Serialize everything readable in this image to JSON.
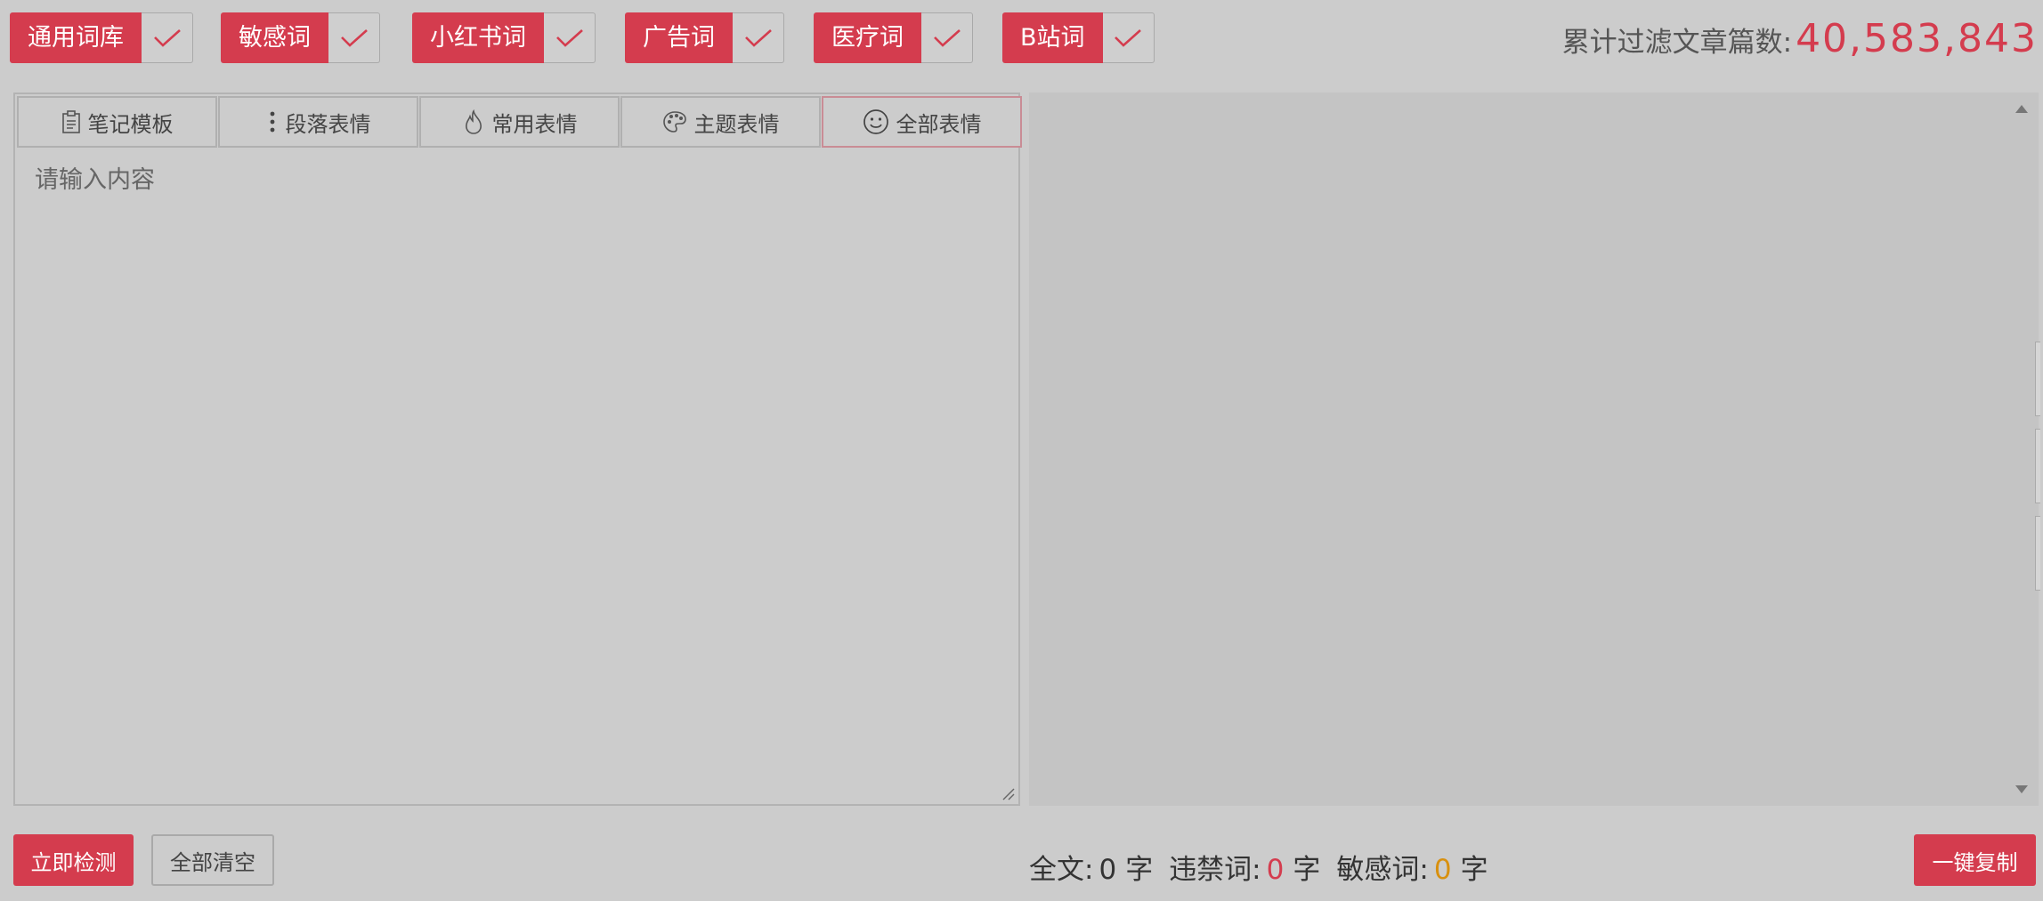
{
  "filters": {
    "tags": [
      {
        "label": "通用词库",
        "checked": true
      },
      {
        "label": "敏感词",
        "checked": true
      },
      {
        "label": "小红书词",
        "checked": true
      },
      {
        "label": "广告词",
        "checked": true
      },
      {
        "label": "医疗词",
        "checked": true
      },
      {
        "label": "B站词",
        "checked": true
      }
    ]
  },
  "counter": {
    "label": "累计过滤文章篇数:",
    "value": "40,583,843"
  },
  "toolbar": {
    "tabs": [
      {
        "label": "笔记模板",
        "icon": "clipboard-icon"
      },
      {
        "label": "段落表情",
        "icon": "vertical-dots-icon"
      },
      {
        "label": "常用表情",
        "icon": "fire-icon"
      },
      {
        "label": "主题表情",
        "icon": "palette-icon"
      },
      {
        "label": "全部表情",
        "icon": "smiley-icon",
        "active": true
      }
    ]
  },
  "editor": {
    "placeholder": "请输入内容",
    "value": ""
  },
  "actions": {
    "detect_label": "立即检测",
    "clear_label": "全部清空",
    "copy_label": "一键复制"
  },
  "stats": {
    "total_label": "全文:",
    "total_value": "0",
    "total_unit": "字",
    "banned_label": "违禁词:",
    "banned_value": "0",
    "banned_unit": "字",
    "sensitive_label": "敏感词:",
    "sensitive_value": "0",
    "sensitive_unit": "字"
  },
  "colors": {
    "accent": "#d43c4e",
    "warning": "#d8900f",
    "background": "#cccccc",
    "preview_background": "#c4c4c4"
  }
}
